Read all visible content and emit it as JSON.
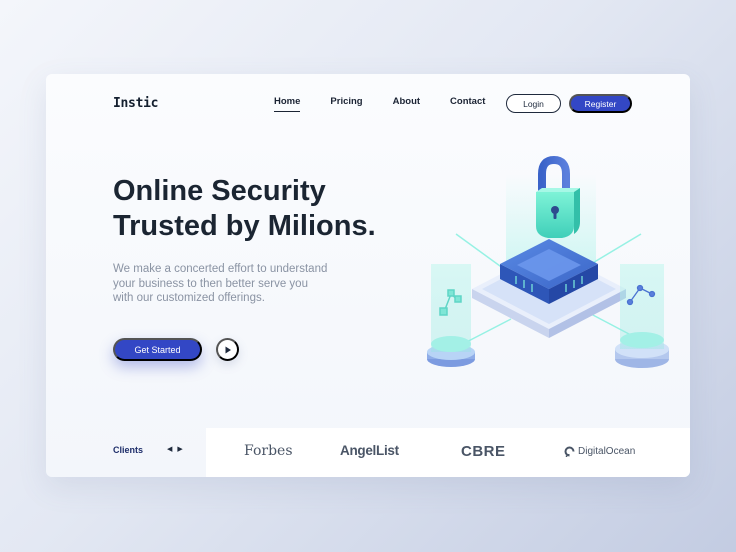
{
  "brand": {
    "logo": "Instic"
  },
  "nav": {
    "items": [
      {
        "label": "Home",
        "active": true
      },
      {
        "label": "Pricing",
        "active": false
      },
      {
        "label": "About",
        "active": false
      },
      {
        "label": "Contact",
        "active": false
      }
    ],
    "login_label": "Login",
    "register_label": "Register"
  },
  "hero": {
    "headline_line1": "Online Security",
    "headline_line2": "Trusted by Milions.",
    "description_line1": "We make a concerted effort to understand",
    "description_line2": "your business to then better serve you",
    "description_line3": "with our customized offerings.",
    "cta_label": "Get Started",
    "play_icon": "play-icon"
  },
  "clients": {
    "label": "Clients",
    "prev_icon": "chevron-left-icon",
    "next_icon": "chevron-right-icon",
    "logos": [
      "Forbes",
      "AngelList",
      "CBRE",
      "DigitalOcean"
    ]
  },
  "colors": {
    "accent": "#3347c5",
    "text_dark": "#1b2532",
    "text_muted": "#8a93a3",
    "illustration_teal": "#5fe0cf",
    "illustration_blue": "#4d79d6"
  }
}
